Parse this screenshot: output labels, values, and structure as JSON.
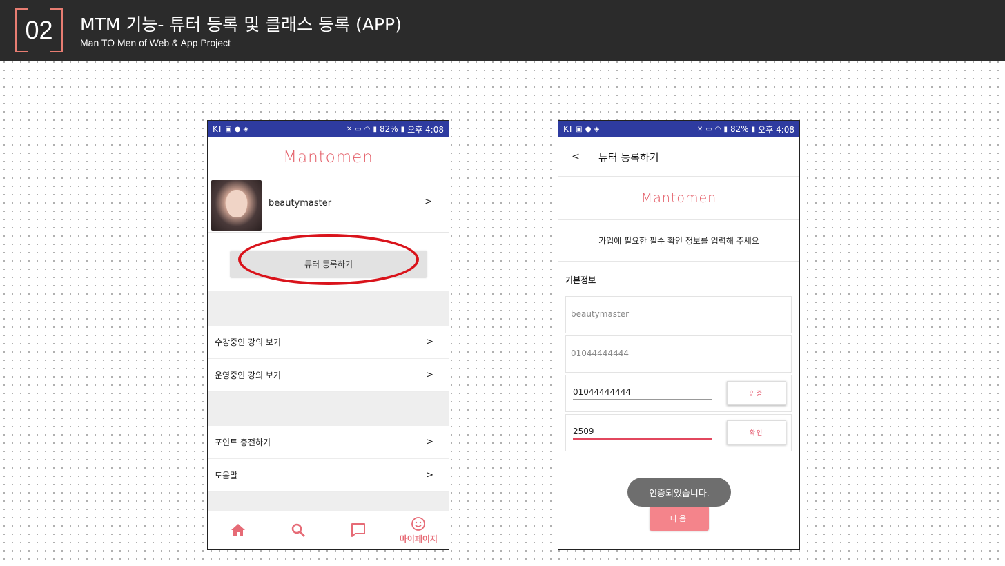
{
  "slide": {
    "number": "02",
    "title": "MTM 기능- 튜터 등록 및 클래스 등록 (APP)",
    "subtitle": "Man TO Men of Web & App Project"
  },
  "status_bar": {
    "carrier": "KT",
    "battery": "82%",
    "time": "오후 4:08"
  },
  "left_screen": {
    "logo": "Mantomen",
    "profile": {
      "username": "beautymaster",
      "arrow": ">"
    },
    "tutor_register_button": "튜터 등록하기",
    "menu": [
      {
        "label": "수강중인 강의 보기",
        "arrow": ">"
      },
      {
        "label": "운영중인 강의 보기",
        "arrow": ">"
      },
      {
        "label": "포인트 충전하기",
        "arrow": ">"
      },
      {
        "label": "도움말",
        "arrow": ">"
      }
    ],
    "bottom_nav": {
      "mypage_label": "마이페이지"
    }
  },
  "right_screen": {
    "back": "<",
    "title": "튜터 등록하기",
    "logo": "Mantomen",
    "instruction": "가입에 필요한 필수 확인 정보를 입력해 주세요",
    "section_label": "기본정보",
    "fields": {
      "username": "beautymaster",
      "phone_readonly": "01044444444",
      "phone_input": "01044444444",
      "verify_button": "인증",
      "code_input": "2509",
      "confirm_button": "확인"
    },
    "toast": "인증되었습니다.",
    "next_button": "다음"
  },
  "colors": {
    "header_bg": "#2b2b2b",
    "accent": "#e87d72",
    "statusbar": "#2e3ba0",
    "brand_pink": "#e4606a",
    "highlight_red": "#d9131b"
  }
}
